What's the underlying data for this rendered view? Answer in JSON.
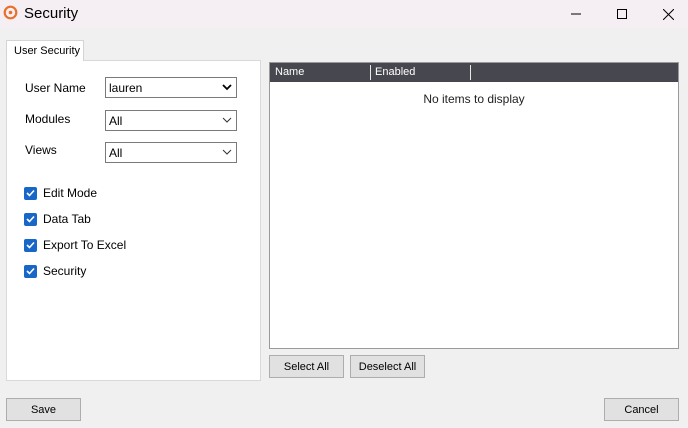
{
  "window": {
    "title": "Security",
    "icon": "orange-ring-icon",
    "controls": [
      "minimize-icon",
      "maximize-icon",
      "close-icon"
    ]
  },
  "tabs": [
    {
      "label": "User Security",
      "active": true
    }
  ],
  "form": {
    "user_name": {
      "label": "User Name",
      "value": "lauren"
    },
    "modules": {
      "label": "Modules",
      "value": "All"
    },
    "views": {
      "label": "Views",
      "value": "All"
    }
  },
  "permissions": [
    {
      "label": "Edit Mode",
      "checked": true
    },
    {
      "label": "Data Tab",
      "checked": true
    },
    {
      "label": "Export To Excel",
      "checked": true
    },
    {
      "label": "Security",
      "checked": true
    }
  ],
  "list": {
    "columns": [
      "Name",
      "Enabled"
    ],
    "empty_text": "No items to display",
    "rows": []
  },
  "buttons": {
    "select_all": "Select All",
    "deselect_all": "Deselect All",
    "save": "Save",
    "cancel": "Cancel"
  },
  "colors": {
    "accent": "#1866c8",
    "header_bg": "#47474f",
    "titlebar_bg": "#f5eef3",
    "app_icon": "#e8702a"
  }
}
